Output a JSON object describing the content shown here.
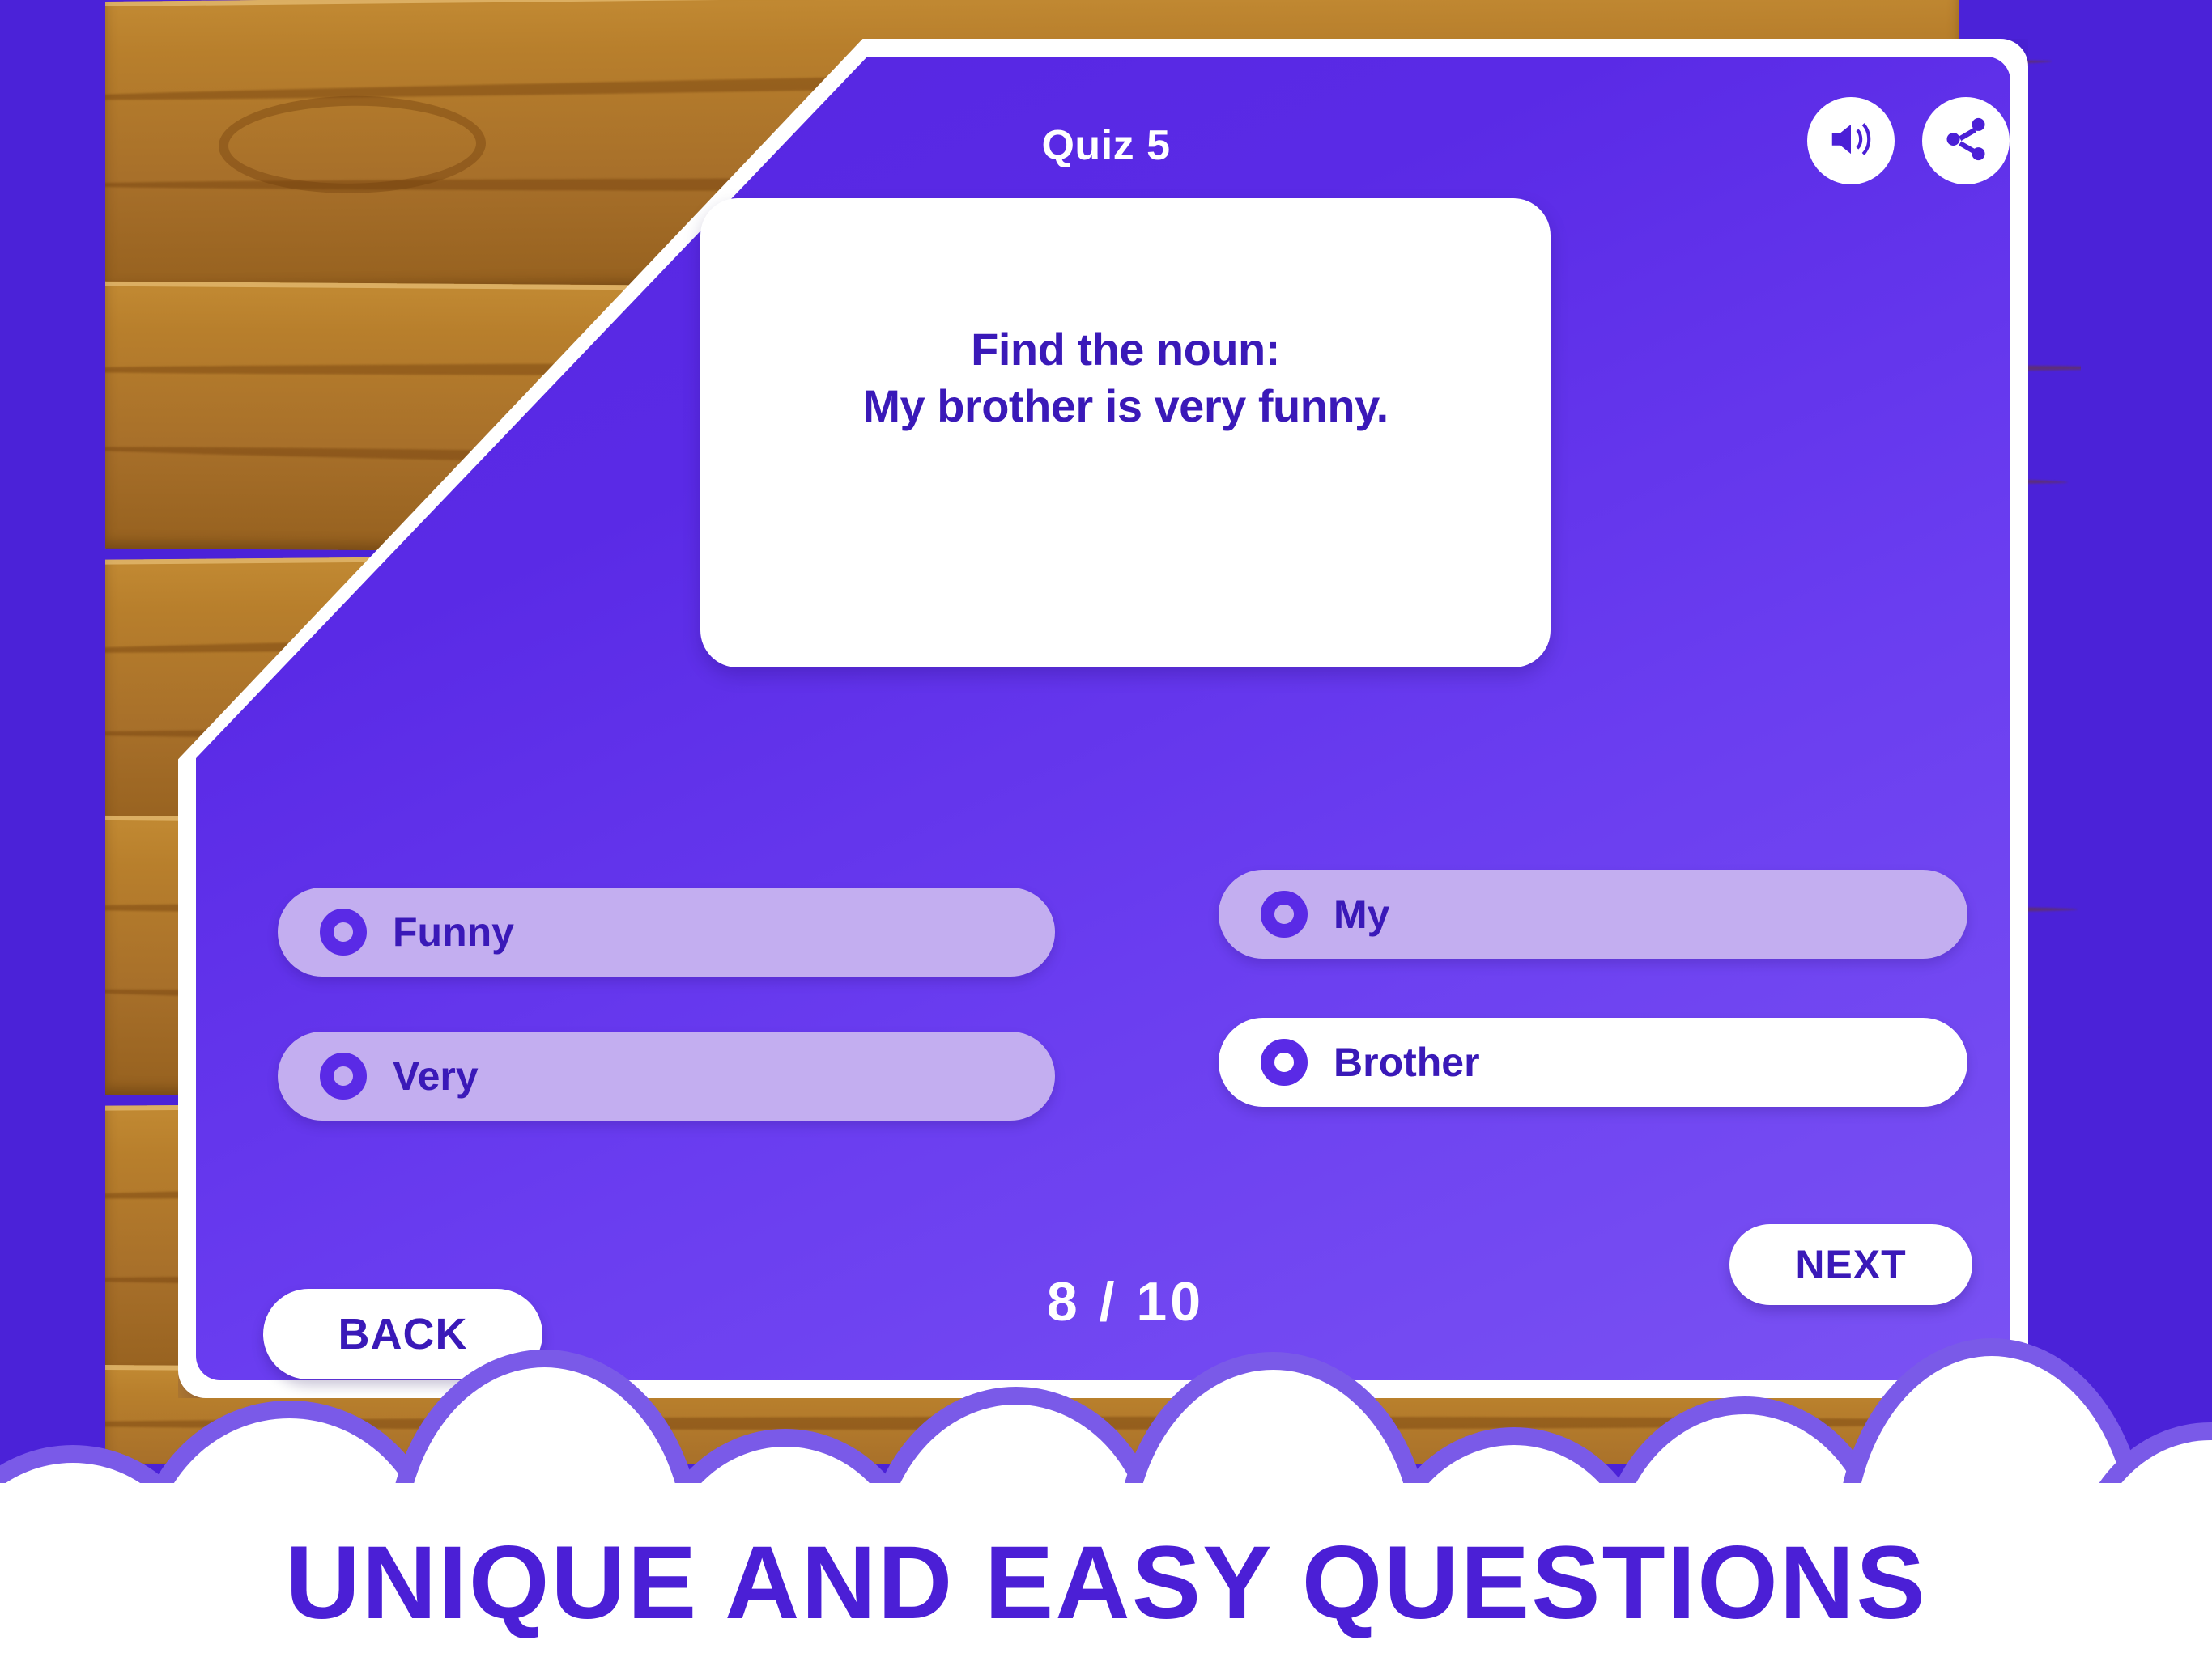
{
  "header": {
    "quiz_title": "Quiz 5",
    "sound_icon": "speaker-volume-icon",
    "share_icon": "share-icon"
  },
  "question": {
    "prompt_line_1": "Find the noun:",
    "prompt_line_2": "My brother is very funny."
  },
  "options": [
    {
      "id": "opt-funny",
      "label": "Funny",
      "selected": false,
      "column": "left",
      "row": 1
    },
    {
      "id": "opt-very",
      "label": "Very",
      "selected": false,
      "column": "left",
      "row": 2
    },
    {
      "id": "opt-my",
      "label": "My",
      "selected": false,
      "column": "right",
      "row": 1
    },
    {
      "id": "opt-brother",
      "label": "Brother",
      "selected": true,
      "column": "right",
      "row": 2
    }
  ],
  "footer": {
    "back_label": "BACK",
    "next_label": "NEXT",
    "progress_counter": "8 / 10",
    "current_question": 8,
    "total_questions": 10
  },
  "banner": {
    "text": "UNIQUE AND EASY QUESTIONS"
  },
  "colors": {
    "background_purple": "#4b22d8",
    "panel_purple_dark": "#5626e0",
    "panel_purple_light": "#7a52f3",
    "text_purple": "#3a19b8",
    "option_dim": "#c3aef0",
    "option_selected": "#ffffff",
    "wood_light": "#c28a33",
    "wood_dark": "#96611f",
    "cloud_outline": "#7a5ae8"
  }
}
